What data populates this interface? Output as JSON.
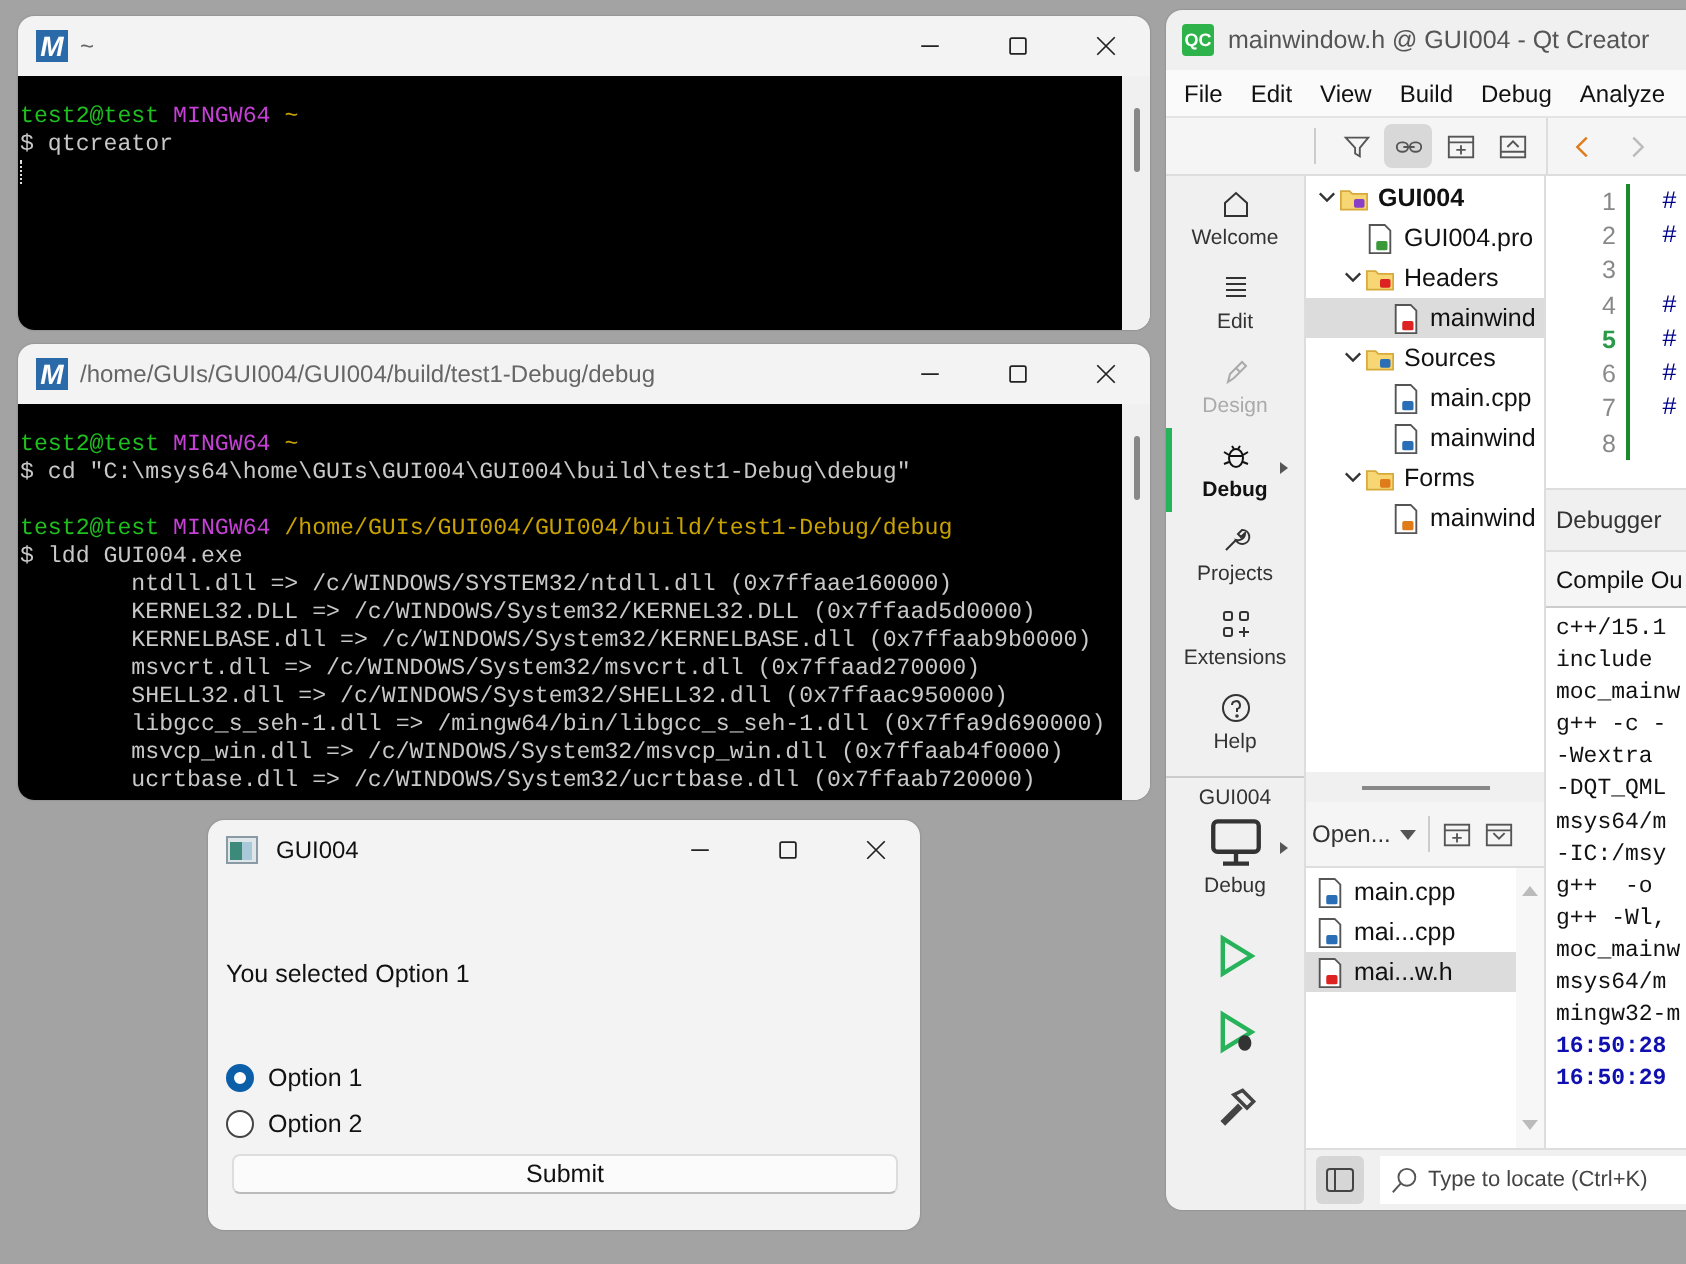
{
  "terminals": [
    {
      "icon_text": "M",
      "title": "~",
      "lines": [
        {
          "kind": "prompt",
          "user": "test2@test",
          "host": "MINGW64",
          "path": "~"
        },
        {
          "kind": "command",
          "text": "$ qtcreator"
        }
      ]
    },
    {
      "icon_text": "M",
      "title": "/home/GUIs/GUI004/GUI004/build/test1-Debug/debug",
      "lines": [
        {
          "kind": "prompt",
          "user": "test2@test",
          "host": "MINGW64",
          "path": "~"
        },
        {
          "kind": "command",
          "text": "$ cd \"C:\\msys64\\home\\GUIs\\GUI004\\GUI004\\build\\test1-Debug\\debug\""
        },
        {
          "kind": "prompt",
          "user": "test2@test",
          "host": "MINGW64",
          "path": "/home/GUIs/GUI004/GUI004/build/test1-Debug/debug"
        },
        {
          "kind": "command",
          "text": "$ ldd GUI004.exe"
        },
        {
          "kind": "output",
          "text": "ntdll.dll => /c/WINDOWS/SYSTEM32/ntdll.dll (0x7ffaae160000)"
        },
        {
          "kind": "output",
          "text": "KERNEL32.DLL => /c/WINDOWS/System32/KERNEL32.DLL (0x7ffaad5d0000)"
        },
        {
          "kind": "output",
          "text": "KERNELBASE.dll => /c/WINDOWS/System32/KERNELBASE.dll (0x7ffaab9b0000)"
        },
        {
          "kind": "output",
          "text": "msvcrt.dll => /c/WINDOWS/System32/msvcrt.dll (0x7ffaad270000)"
        },
        {
          "kind": "output",
          "text": "SHELL32.dll => /c/WINDOWS/System32/SHELL32.dll (0x7ffaac950000)"
        },
        {
          "kind": "output",
          "text": "libgcc_s_seh-1.dll => /mingw64/bin/libgcc_s_seh-1.dll (0x7ffa9d690000)"
        },
        {
          "kind": "output",
          "text": "msvcp_win.dll => /c/WINDOWS/System32/msvcp_win.dll (0x7ffaab4f0000)"
        },
        {
          "kind": "output",
          "text": "ucrtbase.dll => /c/WINDOWS/System32/ucrtbase.dll (0x7ffaab720000)"
        }
      ]
    }
  ],
  "dialog": {
    "title": "GUI004",
    "message": "You selected Option 1",
    "options": [
      {
        "label": "Option 1",
        "selected": true
      },
      {
        "label": "Option 2",
        "selected": false
      }
    ],
    "button": "Submit"
  },
  "qt_creator": {
    "icon_text": "QC",
    "title": "mainwindow.h @ GUI004 - Qt Creator",
    "menu": [
      "File",
      "Edit",
      "View",
      "Build",
      "Debug",
      "Analyze"
    ],
    "project_toolbar": [
      {
        "kind": "filter",
        "pressed": false
      },
      {
        "kind": "link",
        "pressed": true
      },
      {
        "kind": "split",
        "pressed": false
      },
      {
        "kind": "collapse",
        "pressed": false
      }
    ],
    "modes": [
      {
        "kind": "welcome",
        "label": "Welcome",
        "selected": false,
        "disabled": false,
        "submenu": false
      },
      {
        "kind": "edit",
        "label": "Edit",
        "selected": false,
        "disabled": false,
        "submenu": false
      },
      {
        "kind": "design",
        "label": "Design",
        "selected": false,
        "disabled": true,
        "submenu": false
      },
      {
        "kind": "debug",
        "label": "Debug",
        "selected": true,
        "disabled": false,
        "submenu": true
      },
      {
        "kind": "projects",
        "label": "Projects",
        "selected": false,
        "disabled": false,
        "submenu": false
      },
      {
        "kind": "extensions",
        "label": "Extensions",
        "selected": false,
        "disabled": false,
        "submenu": false
      },
      {
        "kind": "help",
        "label": "Help",
        "selected": false,
        "disabled": false,
        "submenu": false
      }
    ],
    "kit": {
      "project": "GUI004",
      "build": "Debug"
    },
    "project_tree": [
      {
        "name": "GUI004",
        "kind": "project",
        "expanded": true,
        "selected": false,
        "children": [
          {
            "name": "GUI004.pro",
            "kind": "pro",
            "selected": false
          },
          {
            "name": "Headers",
            "kind": "header-folder",
            "expanded": true,
            "selected": false,
            "children": [
              {
                "name": "mainwind",
                "kind": "header",
                "selected": true
              }
            ]
          },
          {
            "name": "Sources",
            "kind": "source-folder",
            "expanded": true,
            "selected": false,
            "children": [
              {
                "name": "main.cpp",
                "kind": "source",
                "selected": false
              },
              {
                "name": "mainwind",
                "kind": "source",
                "selected": false
              }
            ]
          },
          {
            "name": "Forms",
            "kind": "form-folder",
            "expanded": true,
            "selected": false,
            "children": [
              {
                "name": "mainwind",
                "kind": "form",
                "selected": false
              }
            ]
          }
        ]
      }
    ],
    "open_documents": {
      "label": "Open...",
      "items": [
        {
          "name": "main.cpp",
          "kind": "source",
          "selected": false
        },
        {
          "name": "mai...cpp",
          "kind": "source",
          "selected": false
        },
        {
          "name": "mai...w.h",
          "kind": "header",
          "selected": true
        }
      ]
    },
    "editor": {
      "lines": [
        {
          "number": "1",
          "code": "#",
          "current": false
        },
        {
          "number": "2",
          "code": "#",
          "current": false
        },
        {
          "number": "3",
          "current": false
        },
        {
          "number": "4",
          "code": "#",
          "current": false
        },
        {
          "number": "5",
          "code": "#",
          "current": true
        },
        {
          "number": "6",
          "code": "#",
          "current": false
        },
        {
          "number": "7",
          "code": "#",
          "current": false
        },
        {
          "number": "8",
          "current": false
        }
      ]
    },
    "output_pane": {
      "selector": "Debugger",
      "tab": "Compile Ou",
      "lines": [
        {
          "text": "c++/15.1",
          "kind": "plain"
        },
        {
          "text": "include",
          "kind": "plain"
        },
        {
          "text": "moc_mainw",
          "kind": "plain"
        },
        {
          "text": "g++ -c -",
          "kind": "plain"
        },
        {
          "text": "-Wextra",
          "kind": "plain"
        },
        {
          "text": "-DQT_QML",
          "kind": "plain"
        },
        {
          "text": "msys64/m",
          "kind": "plain"
        },
        {
          "text": "-IC:/msy",
          "kind": "plain"
        },
        {
          "text": "g++  -o",
          "kind": "plain"
        },
        {
          "text": "g++ -Wl,",
          "kind": "plain"
        },
        {
          "text": "moc_mainw",
          "kind": "plain"
        },
        {
          "text": "msys64/m",
          "kind": "plain"
        },
        {
          "text": "mingw32-m",
          "kind": "plain"
        },
        {
          "text": "16:50:28",
          "kind": "timestamp"
        },
        {
          "text": "16:50:29",
          "kind": "timestamp"
        }
      ]
    },
    "locator": {
      "placeholder": "Type to locate (Ctrl+K)"
    }
  }
}
